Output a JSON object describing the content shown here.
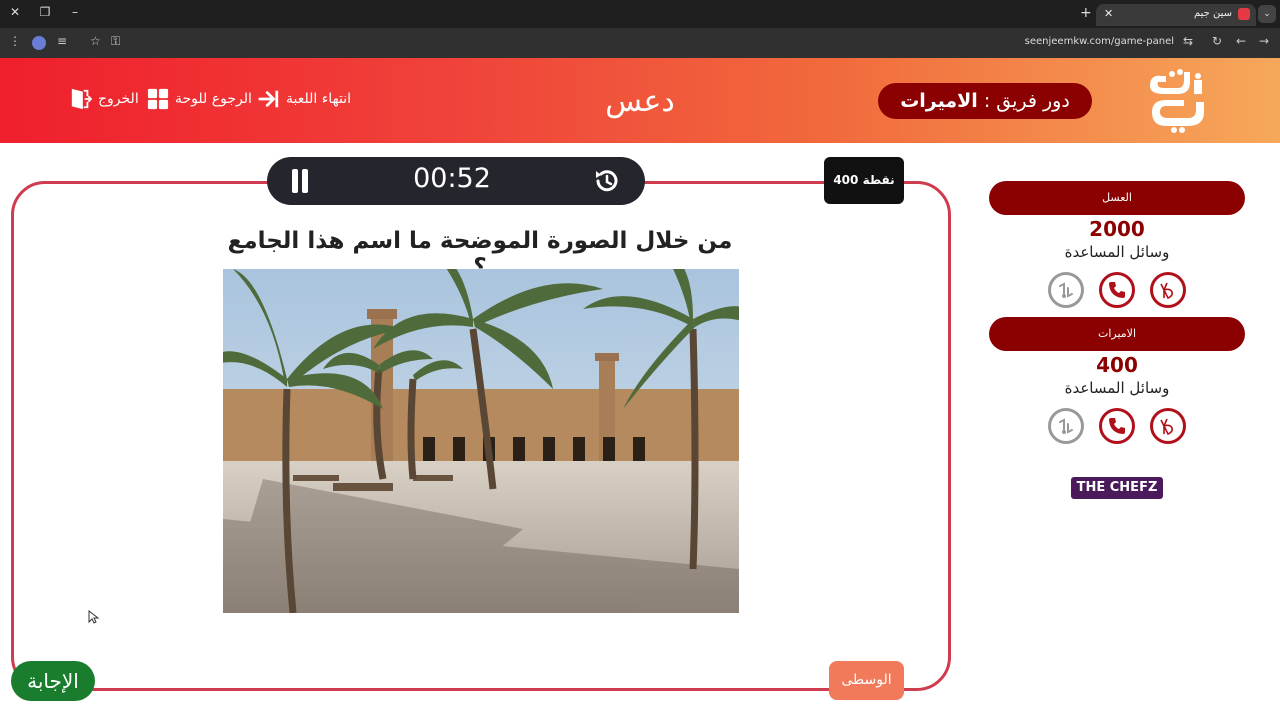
{
  "browser": {
    "tab_title": "سين جيم",
    "url": "seenjeemkw.com/game-panel"
  },
  "header": {
    "logo_text": "سين جيم",
    "turn_label": "دور فريق :",
    "turn_team": "الاميرات",
    "center_title": "دعس",
    "nav": {
      "end_game": "انتهاء اللعبة",
      "back_to_board": "الرجوع للوحة",
      "exit": "الخروج"
    }
  },
  "question_panel": {
    "timer": "00:52",
    "points": "400 نقطة",
    "question": "من خلال الصورة الموضحة ما اسم هذا الجامع ؟",
    "answer_button": "الإجابة",
    "category": "الوسطى"
  },
  "teams": [
    {
      "name": "العسل",
      "score": "2000",
      "aids_label": "وسائل المساعدة"
    },
    {
      "name": "الاميرات",
      "score": "400",
      "aids_label": "وسائل المساعدة"
    }
  ],
  "sponsor": "THE CHEFZ",
  "colors": {
    "accent_dark_red": "#8b0000",
    "header_gradient_start": "#ef1f2c",
    "header_gradient_end": "#f6a85a",
    "answer_green": "#1a7d2e",
    "category_orange": "#f07a5a"
  },
  "icons": {
    "aids": [
      "two-answers-icon",
      "call-friend-icon",
      "hole-icon"
    ],
    "nav": [
      "end-game-icon",
      "board-icon",
      "exit-icon"
    ]
  }
}
